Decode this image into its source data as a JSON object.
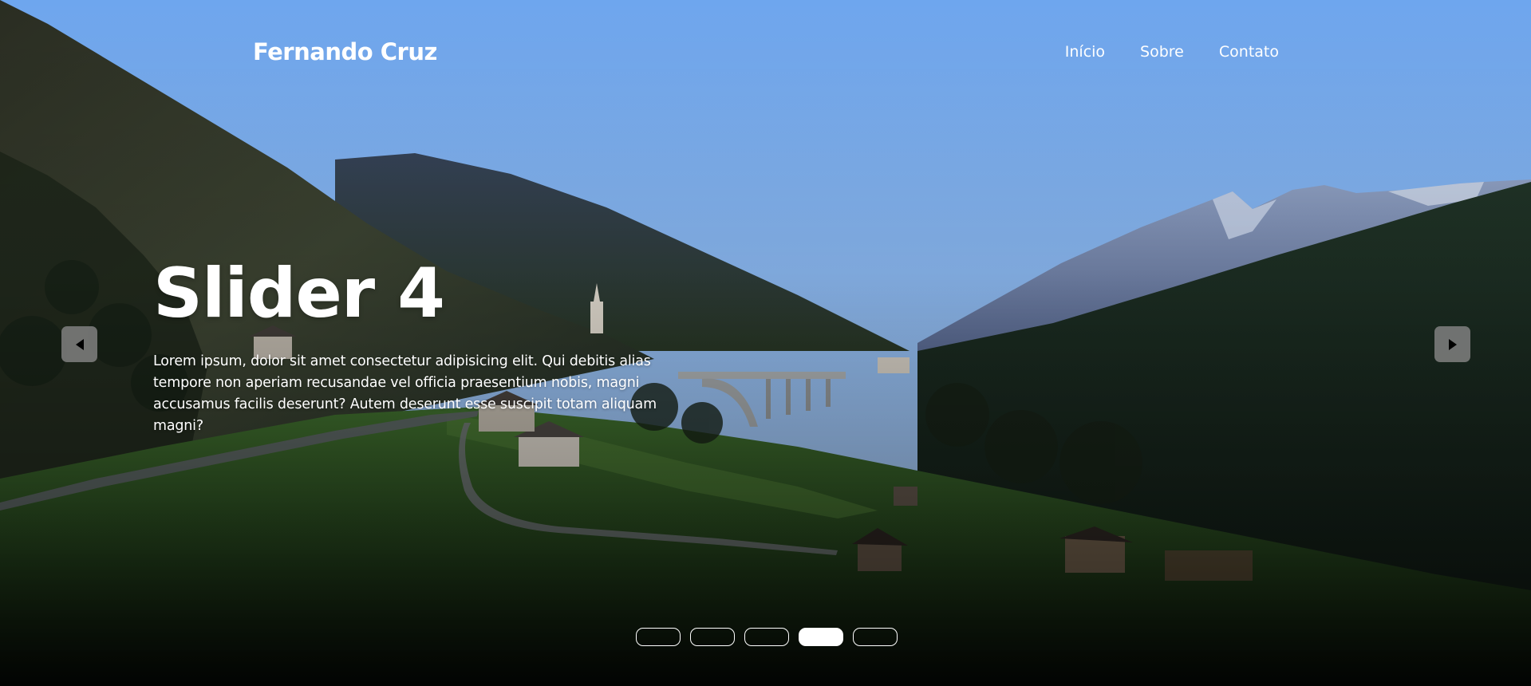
{
  "header": {
    "brand": "Fernando Cruz",
    "nav": [
      {
        "label": "Início"
      },
      {
        "label": "Sobre"
      },
      {
        "label": "Contato"
      }
    ]
  },
  "slider": {
    "title": "Slider 4",
    "description": "Lorem ipsum, dolor sit amet consectetur adipisicing elit. Qui debitis alias tempore non aperiam recusandae vel officia praesentium nobis, magni accusamus facilis deserunt? Autem deserunt esse suscipit totam aliquam magni?",
    "prev_icon": "chevron-left-icon",
    "next_icon": "chevron-right-icon",
    "slide_count": 5,
    "active_slide": 4
  },
  "colors": {
    "sky_top": "#6fa4ea",
    "sky_bottom": "#9fbfe6",
    "text": "#ffffff",
    "arrow_bg": "#808080",
    "indicator_active": "#ffffff"
  }
}
